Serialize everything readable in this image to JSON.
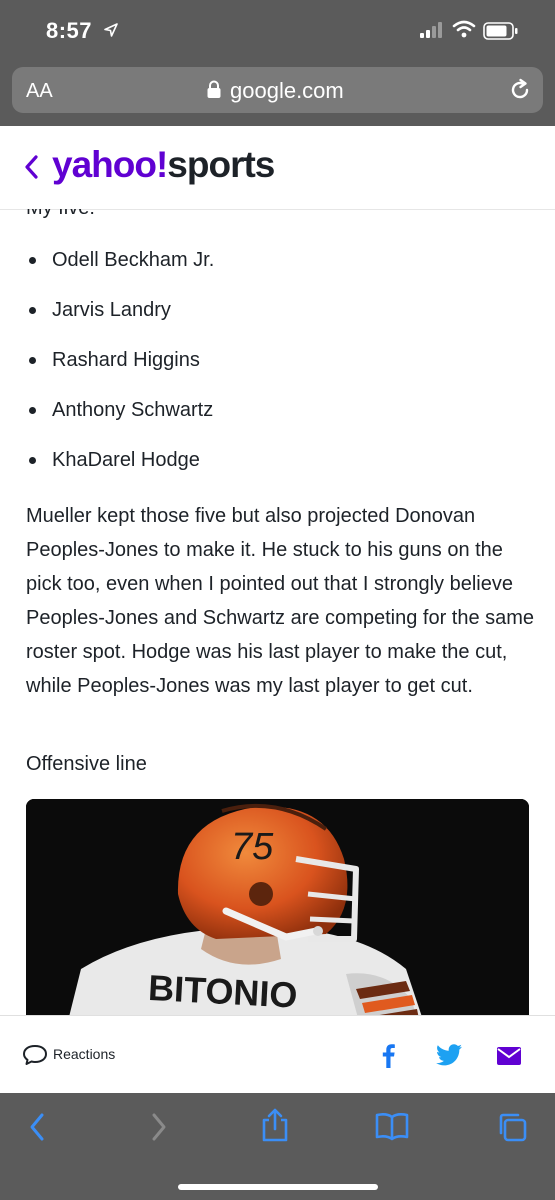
{
  "status_bar": {
    "time": "8:57"
  },
  "browser": {
    "text_size_button": "AA",
    "url": "google.com"
  },
  "site": {
    "brand_yahoo": "yahoo",
    "brand_excl": "!",
    "brand_sports": "sports",
    "brand_color": "#6001d2"
  },
  "article": {
    "cut_heading": "My five:",
    "players": [
      "Odell Beckham Jr.",
      "Jarvis Landry",
      "Rashard Higgins",
      "Anthony Schwartz",
      "KhaDarel Hodge"
    ],
    "paragraph": "Mueller kept those five but also projected Donovan Peoples-Jones to make it. He stuck to his guns on the pick too, even when I pointed out that I strongly believe Peoples-Jones and Schwartz are competing for the same roster spot. Hodge was his last player to make the cut, while Peoples-Jones was my last player to get cut.",
    "subhead": "Offensive line",
    "photo": {
      "helmet_number": "75",
      "jersey_name": "BITONIO"
    }
  },
  "share_bar": {
    "reactions_label": "Reactions"
  },
  "icons": {
    "location": "location-arrow-icon",
    "signal": "cellular-signal-icon",
    "wifi": "wifi-icon",
    "battery": "battery-icon",
    "lock": "lock-icon",
    "reload": "reload-icon",
    "back": "chevron-left-icon",
    "comment": "comment-icon",
    "facebook": "facebook-icon",
    "twitter": "twitter-icon",
    "mail": "mail-icon",
    "share": "share-icon",
    "bookmarks": "book-icon",
    "tabs": "tabs-icon"
  }
}
